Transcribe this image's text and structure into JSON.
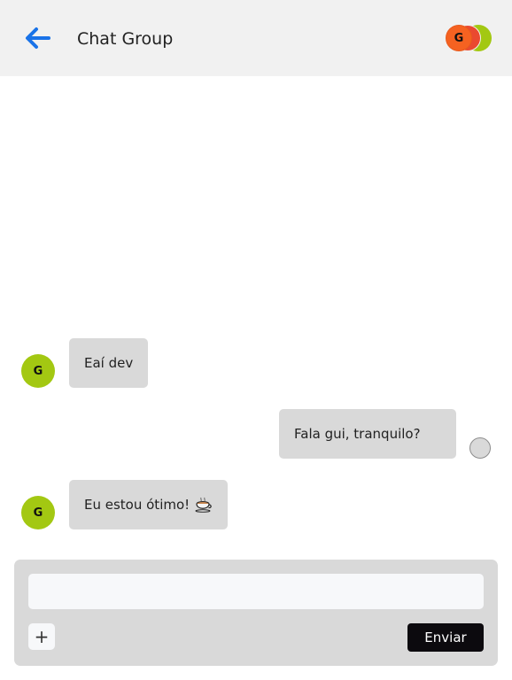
{
  "header": {
    "back_icon": "arrow-left-icon",
    "title": "Chat Group",
    "participants": [
      {
        "initial": "G",
        "color": "#f56221"
      },
      {
        "initial": "",
        "color": "#ea4a30"
      },
      {
        "initial": "",
        "color": "#a3c812"
      }
    ]
  },
  "messages": [
    {
      "sender": "other",
      "avatar_initial": "G",
      "avatar_color": "#a3c812",
      "text": "Eaí dev"
    },
    {
      "sender": "self",
      "avatar_color": "#d9d9d9",
      "text": "Fala gui, tranquilo?"
    },
    {
      "sender": "other",
      "avatar_initial": "G",
      "avatar_color": "#a3c812",
      "text": "Eu estou ótimo!",
      "emoji_icon": "hot-beverage-icon"
    }
  ],
  "composer": {
    "input_value": "",
    "input_placeholder": "",
    "attach_label": "+",
    "send_label": "Enviar"
  },
  "colors": {
    "accent": "#1a73e8",
    "header_bg": "#f1f1f1",
    "bubble_bg": "#d9d9d9",
    "send_bg": "#0c0a0e"
  }
}
